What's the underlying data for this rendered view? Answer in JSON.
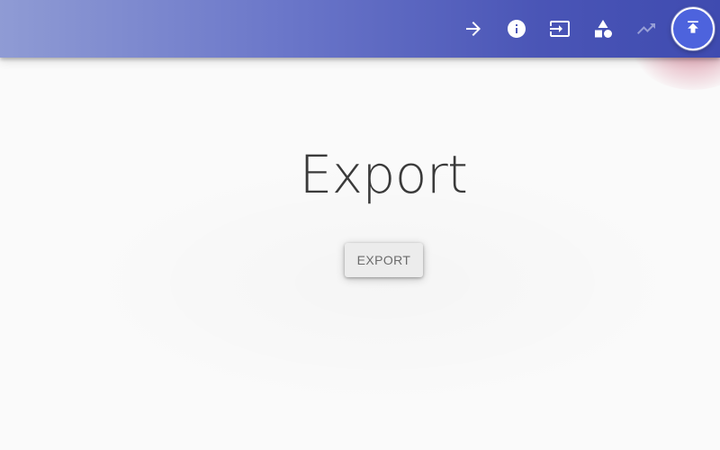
{
  "app_bar": {
    "gradient_start": "#8f9bd4",
    "gradient_end": "#3f4bb0",
    "glow_color": "#c8143c",
    "actions": [
      {
        "icon": "arrow-right-icon"
      },
      {
        "icon": "info-icon"
      },
      {
        "icon": "input-icon"
      },
      {
        "icon": "shapes-icon"
      },
      {
        "icon": "trending-icon",
        "dimmed": true
      },
      {
        "icon": "publish-icon",
        "style": "fab",
        "color": "#4d63dd"
      }
    ]
  },
  "main": {
    "title": "Export",
    "export_button_label": "EXPORT"
  }
}
